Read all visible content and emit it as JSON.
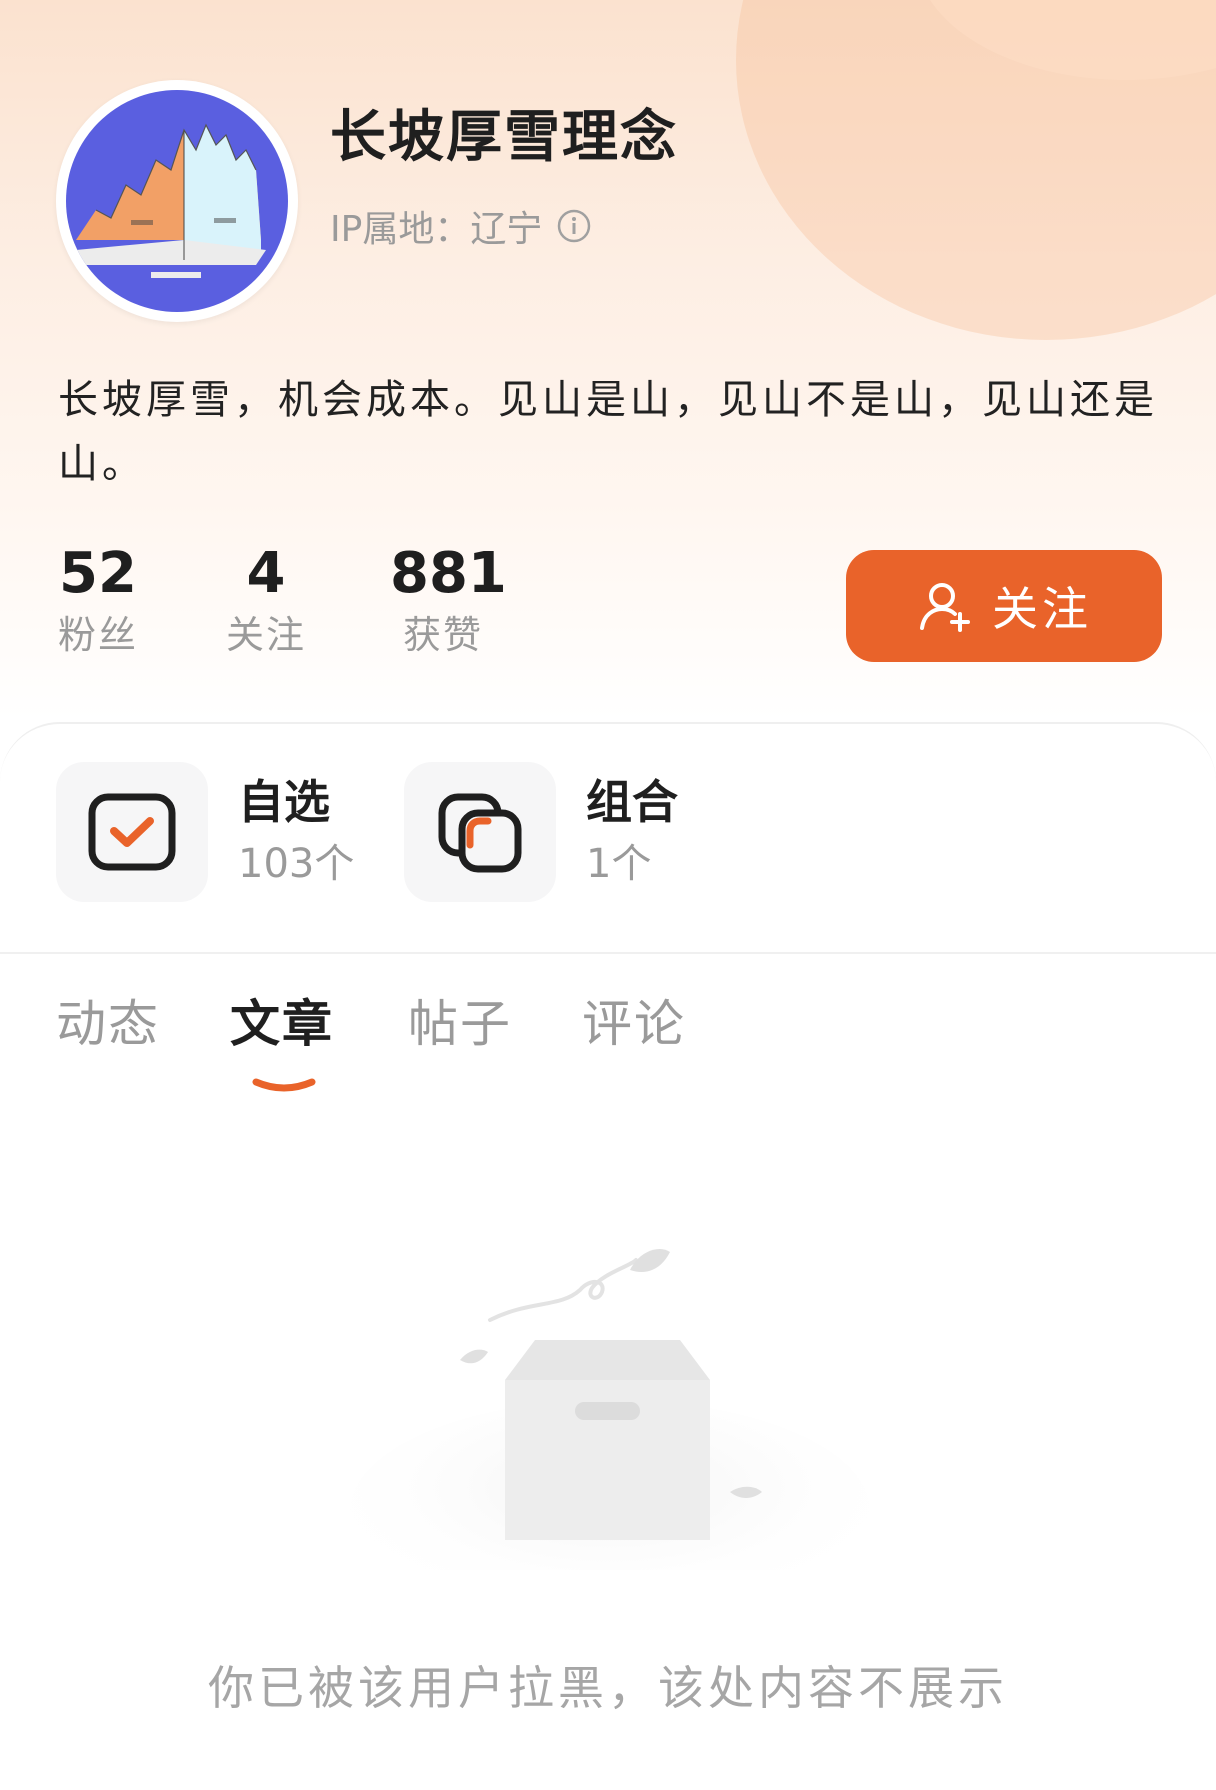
{
  "profile": {
    "username": "长坡厚雪理念",
    "ip_label": "IP属地：辽宁",
    "bio": "长坡厚雪，机会成本。见山是山，见山不是山，见山还是山。"
  },
  "stats": {
    "fans": {
      "value": "52",
      "label": "粉丝"
    },
    "following": {
      "value": "4",
      "label": "关注"
    },
    "likes": {
      "value": "881",
      "label": "获赞"
    }
  },
  "follow_button": {
    "label": "关注"
  },
  "assets": {
    "watchlist": {
      "title": "自选",
      "count": "103个"
    },
    "portfolio": {
      "title": "组合",
      "count": "1个"
    }
  },
  "tabs": {
    "items": [
      {
        "label": "动态"
      },
      {
        "label": "文章"
      },
      {
        "label": "帖子"
      },
      {
        "label": "评论"
      }
    ],
    "active_index": 1
  },
  "empty_state": {
    "message": "你已被该用户拉黑，该处内容不展示"
  },
  "colors": {
    "accent": "#e9632a",
    "header_gradient": "#fbe2cf",
    "muted_text": "#9a9a9a",
    "avatar_bg": "#5a5fe0"
  },
  "icons": {
    "info": "info-icon",
    "follow": "add-user-icon",
    "watchlist": "checkbox-check-icon",
    "portfolio": "stacked-squares-icon",
    "empty": "empty-box-icon"
  }
}
